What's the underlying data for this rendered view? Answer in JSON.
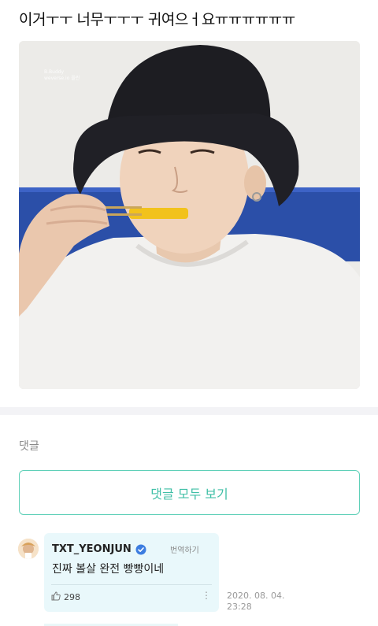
{
  "post": {
    "title": "이거ㅜㅜ 너무ㅜㅜㅜ 귀여으ㅓ요ㅠㅠㅠㅠㅠㅠ",
    "image_watermark_line1": "B.Buddy",
    "image_watermark_line2": "weverse.io 올린"
  },
  "comments": {
    "heading": "댓글",
    "view_all_label": "댓글 모두 보기",
    "items": [
      {
        "author": "TXT_YEONJUN",
        "translate_label": "번역하기",
        "text": "진짜 볼살 완전 빵빵이네",
        "likes": "298",
        "more": "⋮",
        "date": "2020. 08. 04.",
        "time": "23:28"
      }
    ]
  },
  "colors": {
    "accent": "#3fbfa6",
    "bubble_bg": "#e9f8fb",
    "divider": "#f3f3f6"
  },
  "icons": [
    "verified-badge-icon",
    "thumbs-up-icon",
    "more-options-icon"
  ]
}
